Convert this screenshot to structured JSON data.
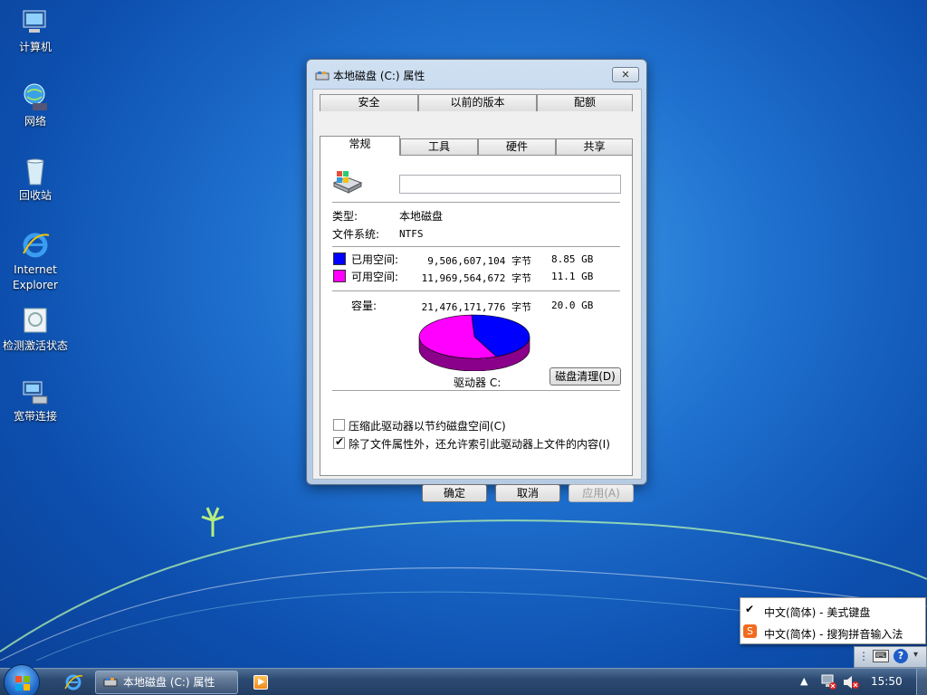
{
  "desktop": {
    "icons": [
      {
        "label": "计算机"
      },
      {
        "label": "网络"
      },
      {
        "label": "回收站"
      },
      {
        "label": "Internet Explorer"
      },
      {
        "label": "检测激活状态"
      },
      {
        "label": "宽带连接"
      }
    ]
  },
  "dialog": {
    "title": "本地磁盘 (C:) 属性",
    "close_label": "✕",
    "tabs_back": [
      "安全",
      "以前的版本",
      "配额"
    ],
    "tabs_front": [
      "常规",
      "工具",
      "硬件",
      "共享"
    ],
    "active_tab": "常规",
    "name_value": "",
    "type_label": "类型:",
    "type_value": "本地磁盘",
    "fs_label": "文件系统:",
    "fs_value": "NTFS",
    "used_label": "已用空间:",
    "used_bytes": "9,506,607,104 字节",
    "used_gb": "8.85 GB",
    "free_label": "可用空间:",
    "free_bytes": "11,969,564,672 字节",
    "free_gb": "11.1 GB",
    "cap_label": "容量:",
    "cap_bytes": "21,476,171,776 字节",
    "cap_gb": "20.0 GB",
    "drive_label": "驱动器 C:",
    "cleanup_label": "磁盘清理(D)",
    "compress_label": "压缩此驱动器以节约磁盘空间(C)",
    "compress_checked": false,
    "index_label": "除了文件属性外，还允许索引此驱动器上文件的内容(I)",
    "index_checked": true,
    "ok_label": "确定",
    "cancel_label": "取消",
    "apply_label": "应用(A)",
    "used_fraction": 0.4427,
    "used_color": "#0000ff",
    "free_color": "#ff00ff"
  },
  "language_menu": {
    "items": [
      {
        "label": "中文(简体) - 美式键盘",
        "checked": true
      },
      {
        "label": "中文(简体) - 搜狗拼音输入法",
        "checked": false
      }
    ]
  },
  "taskbar": {
    "active_window": "本地磁盘 (C:) 属性",
    "clock": "15:50"
  }
}
